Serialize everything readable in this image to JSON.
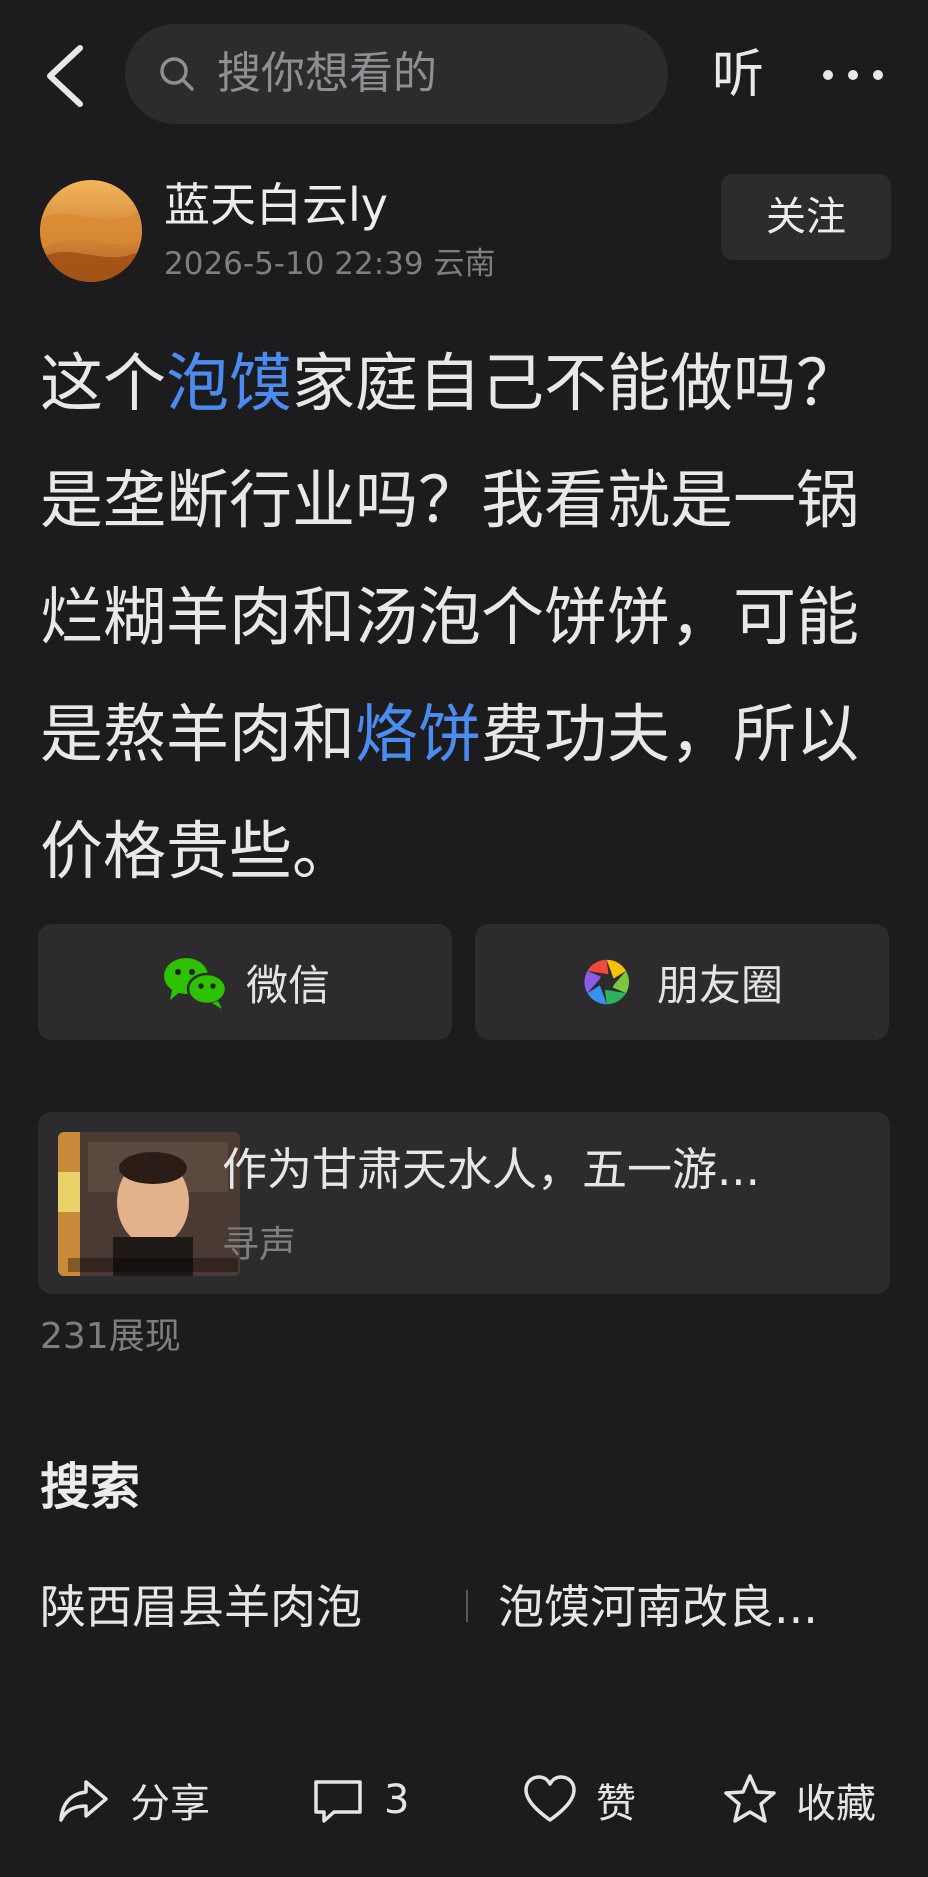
{
  "header": {
    "search_placeholder": "搜你想看的",
    "listen_label": "听"
  },
  "author": {
    "name": "蓝天白云ly",
    "meta": "2026-5-10 22:39 云南",
    "follow_label": "关注"
  },
  "post": {
    "seg1": "这个",
    "link1": "泡馍",
    "seg2": "家庭自己不能做吗？是垄断行业吗？我看就是一锅烂糊羊肉和汤泡个饼饼，可能是熬羊肉和",
    "link2": "烙饼",
    "seg3": "费功夫，所以价格贵些。"
  },
  "share": {
    "wechat_label": "微信",
    "moments_label": "朋友圈"
  },
  "related": {
    "title": "作为甘肃天水人，五一游...",
    "source": "寻声"
  },
  "views": "231展现",
  "search_section": {
    "title": "搜索",
    "items": [
      "陕西眉县羊肉泡",
      "泡馍河南改良..."
    ]
  },
  "bottom_bar": {
    "share_label": "分享",
    "comment_count": "3",
    "like_label": "赞",
    "favorite_label": "收藏"
  },
  "colors": {
    "background": "#1c1c1e",
    "card": "#2c2c2e",
    "link": "#4a8cf0",
    "secondary_text": "#7d7d82"
  }
}
